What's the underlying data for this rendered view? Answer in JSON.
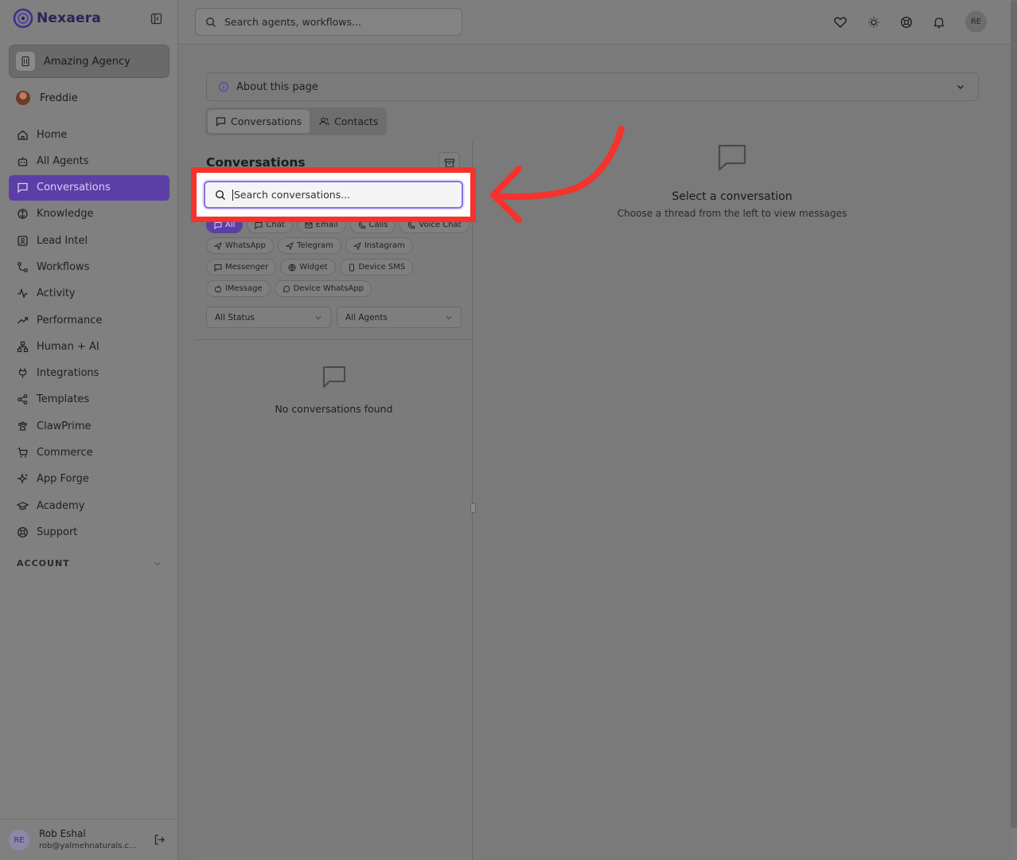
{
  "brand": {
    "name": "Nexaera"
  },
  "agency": {
    "name": "Amazing Agency"
  },
  "user": {
    "name": "Freddie"
  },
  "nav": [
    {
      "label": "Home",
      "icon": "home-icon"
    },
    {
      "label": "All Agents",
      "icon": "bot-icon"
    },
    {
      "label": "Conversations",
      "icon": "message-icon",
      "active": true
    },
    {
      "label": "Knowledge",
      "icon": "brain-icon"
    },
    {
      "label": "Lead Intel",
      "icon": "contact-card-icon"
    },
    {
      "label": "Workflows",
      "icon": "workflow-icon"
    },
    {
      "label": "Activity",
      "icon": "activity-icon"
    },
    {
      "label": "Performance",
      "icon": "trending-up-icon"
    },
    {
      "label": "Human + AI",
      "icon": "network-icon"
    },
    {
      "label": "Integrations",
      "icon": "plug-icon"
    },
    {
      "label": "Templates",
      "icon": "share-icon"
    },
    {
      "label": "ClawPrime",
      "icon": "paw-icon"
    },
    {
      "label": "Commerce",
      "icon": "cart-icon"
    },
    {
      "label": "App Forge",
      "icon": "sparkles-icon"
    },
    {
      "label": "Academy",
      "icon": "graduation-cap-icon"
    },
    {
      "label": "Support",
      "icon": "lifebuoy-icon"
    }
  ],
  "account": {
    "label": "ACCOUNT"
  },
  "footer": {
    "initials": "RE",
    "name": "Rob Eshal",
    "email": "rob@yalmehnaturals.com"
  },
  "topbar": {
    "search_placeholder": "Search agents, workflows...",
    "avatar_initials": "RE"
  },
  "about": {
    "label": "About this page"
  },
  "tabs": {
    "conversations": "Conversations",
    "contacts": "Contacts"
  },
  "conversations": {
    "title": "Conversations",
    "search_placeholder": "Search conversations...",
    "chips": [
      "All",
      "Chat",
      "Email",
      "Calls",
      "Voice Chat",
      "WhatsApp",
      "Telegram",
      "Instagram",
      "Messenger",
      "Widget",
      "Device SMS",
      "iMessage",
      "Device WhatsApp"
    ],
    "status_filter": "All Status",
    "agent_filter": "All Agents",
    "empty_text": "No conversations found"
  },
  "detail": {
    "title": "Select a conversation",
    "subtitle": "Choose a thread from the left to view messages"
  },
  "colors": {
    "accent": "#5b3fa6",
    "highlight": "#f5322b",
    "focus_ring": "#8b6fe0"
  }
}
